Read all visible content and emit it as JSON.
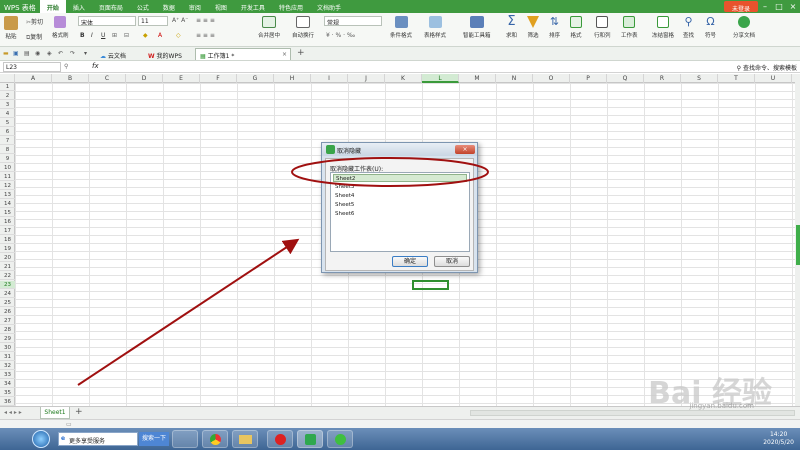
{
  "app": {
    "menu_label": "WPS 表格",
    "signin_label": "未登录"
  },
  "ribbon_tabs": [
    "开始",
    "插入",
    "页面布局",
    "公式",
    "数据",
    "审阅",
    "视图",
    "开发工具",
    "特色应用",
    "文档助手"
  ],
  "ribbon": {
    "paste": "粘贴",
    "cut": "剪切",
    "copy": "复制",
    "format_painter": "格式刷",
    "font_name": "宋体",
    "font_size": "11",
    "merge_center": "合并居中",
    "wrap_text": "自动换行",
    "number_format": "常规",
    "conditional_format": "条件格式",
    "table_style": "表格样式",
    "smart_toolbox": "智能工具箱",
    "sum": "求和",
    "filter": "筛选",
    "sort": "排序",
    "format": "格式",
    "row_col": "行和列",
    "worksheet": "工作表",
    "freeze": "冻结窗格",
    "find": "查找",
    "symbol": "符号",
    "share": "分享文档"
  },
  "doc_tabs": [
    "云文档",
    "我的WPS",
    "工作簿1 *"
  ],
  "formula_bar": {
    "cell_ref": "L23",
    "fx_label": "fx",
    "hint": "查找命令、搜索模板"
  },
  "columns": [
    "A",
    "B",
    "C",
    "D",
    "E",
    "F",
    "G",
    "H",
    "I",
    "J",
    "K",
    "L",
    "M",
    "N",
    "O",
    "P",
    "Q",
    "R",
    "S",
    "T",
    "U"
  ],
  "selected_column": "L",
  "rows": [
    "1",
    "2",
    "3",
    "4",
    "5",
    "6",
    "7",
    "8",
    "9",
    "10",
    "11",
    "12",
    "13",
    "14",
    "15",
    "16",
    "17",
    "18",
    "19",
    "20",
    "21",
    "22",
    "23",
    "24",
    "25",
    "26",
    "27",
    "28",
    "29",
    "30",
    "31",
    "32",
    "33",
    "34",
    "35",
    "36"
  ],
  "selected_row": "23",
  "sheet_tab": "Sheet1",
  "dialog": {
    "title": "取消隐藏",
    "label": "取消隐藏工作表(U):",
    "items": [
      "Sheet2",
      "Sheet3",
      "Sheet4",
      "Sheet5",
      "Sheet6"
    ],
    "ok_label": "确定",
    "cancel_label": "取消"
  },
  "taskbar": {
    "search_text": "更多享受服务",
    "search_button": "搜索一下",
    "time": "14:20",
    "date": "2020/5/20"
  },
  "watermark": {
    "brand": "Bai 经验",
    "url": "jingyan.baidu.com"
  },
  "colors": {
    "wps_green": "#3f9a3f",
    "annotation_red": "#a01010",
    "selection_green": "#2f8f2f"
  }
}
